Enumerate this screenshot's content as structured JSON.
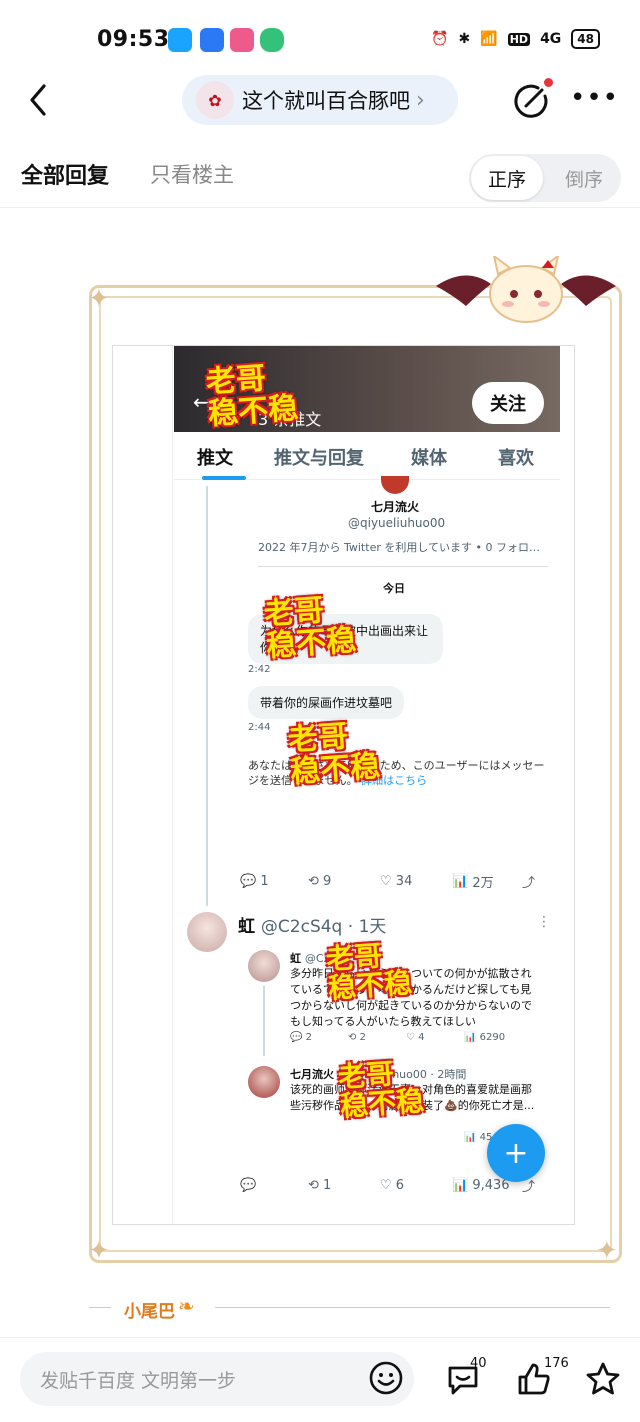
{
  "status": {
    "time": "09:53",
    "network": "4G",
    "battery": "48"
  },
  "nav": {
    "forum_name": "这个就叫百合豚吧",
    "chevron": "›"
  },
  "tabs": {
    "all_replies": "全部回复",
    "only_op": "只看楼主"
  },
  "order": {
    "asc": "正序",
    "desc": "倒序"
  },
  "screenshot": {
    "header_count": "3 条推文",
    "follow_label": "关注",
    "tabs": [
      "推文",
      "推文与回复",
      "媒体",
      "喜欢"
    ],
    "profile_name": "七月流火",
    "profile_handle": "@qiyueliuhuo00",
    "profile_since": "2022 年7月から Twitter を利用しています • 0 フォロ…",
    "today": "今日",
    "dm1": "为什么你的母亲被中出画出来让你的...",
    "dm1_time": "2:42",
    "dm2": "带着你的屎画作进坟墓吧",
    "dm2_time": "2:44",
    "warning": "あなたは認証されていないため、このユーザーにはメッセージを送信できません。",
    "warning_link": "詳細はこちら",
    "tweet1_actions": {
      "reply": "1",
      "retweet": "9",
      "like": "34",
      "views": "2万"
    },
    "reply_author": "虹",
    "reply_handle": "@C2cS4q · 1天",
    "quote1": {
      "author": "虹",
      "handle": "@C2cS...",
      "text": "多分昨日くらいから私についての何かが拡散されているでしょう？噂は分かるんだけど探しても見つからないし何が起きているのか分からないのでもし知ってる人がいたら教えてほしい",
      "reply": "2",
      "retweet": "2",
      "like": "4",
      "views": "6290"
    },
    "quote2": {
      "author": "七月流火",
      "handle": "@qiyueliuhuo00 · 2時間",
      "text": "该死的画师，你活该无辜，对角色的喜爱就是画那些污秽作品的吗，对脑子里装了💩的你死亡才是...",
      "views": "45"
    },
    "tweet2_actions": {
      "retweet": "1",
      "like": "6",
      "views": "9,436"
    },
    "stamp_text": "老哥\n稳不稳"
  },
  "tail_label": "小尾巴",
  "bottom": {
    "compose_placeholder": "发贴千百度 文明第一步",
    "comment_count": "40",
    "like_count": "176"
  },
  "colors": {
    "accent_blue": "#1d9bf0",
    "frame_gold": "#e4cfa8",
    "tail_orange": "#e07b1b",
    "notify_red": "#e8333a"
  },
  "icons": [
    "back-arrow-icon",
    "edit-icon",
    "more-icon",
    "smile-icon",
    "comment-icon",
    "thumbs-up-icon",
    "star-icon"
  ]
}
